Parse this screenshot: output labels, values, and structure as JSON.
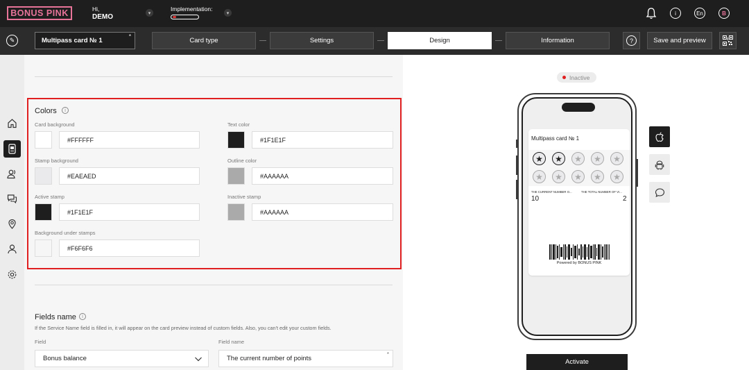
{
  "header": {
    "logo": "BONUS PINK",
    "greeting": "Hi,",
    "user": "DEMO",
    "implementation_label": "Implementation:",
    "language": "En",
    "avatar_letter": "B"
  },
  "toolbar": {
    "card_name": "Multipass card № 1",
    "required_mark": "*",
    "steps": [
      "Card type",
      "Settings",
      "Design",
      "Information"
    ],
    "active_step": "Design",
    "help": "?",
    "save_label": "Save and preview"
  },
  "colors": {
    "title": "Colors",
    "fields": [
      {
        "label": "Card background",
        "value": "#FFFFFF",
        "swatch": "#FFFFFF"
      },
      {
        "label": "Text color",
        "value": "#1F1E1F",
        "swatch": "#1F1E1F"
      },
      {
        "label": "Stamp background",
        "value": "#EAEAED",
        "swatch": "#EAEAED"
      },
      {
        "label": "Outline color",
        "value": "#AAAAAA",
        "swatch": "#AAAAAA"
      },
      {
        "label": "Active stamp",
        "value": "#1F1E1F",
        "swatch": "#1F1E1F"
      },
      {
        "label": "Inactive stamp",
        "value": "#AAAAAA",
        "swatch": "#AAAAAA"
      },
      {
        "label": "Background under stamps",
        "value": "#F6F6F6",
        "swatch": "#F6F6F6"
      }
    ]
  },
  "fields_name": {
    "title": "Fields name",
    "note": "If the Service Name field is filled in, it will appear on the card preview instead of custom fields. Also, you can't edit your custom fields.",
    "field_label": "Field",
    "field_value": "Bonus balance",
    "field_name_label": "Field name",
    "field_name_value": "The current number of points",
    "required_mark": "*"
  },
  "preview": {
    "status": "Inactive",
    "card_title": "Multipass card № 1",
    "stamps_active": 2,
    "stamps_total": 10,
    "field1_label": "THE CURRENT NUMBER O...",
    "field1_value": "10",
    "field2_label": "THE TOTAL NUMBER OF VI...",
    "field2_value": "2",
    "powered": "Powered by BONUS PINK",
    "activate_label": "Activate"
  }
}
